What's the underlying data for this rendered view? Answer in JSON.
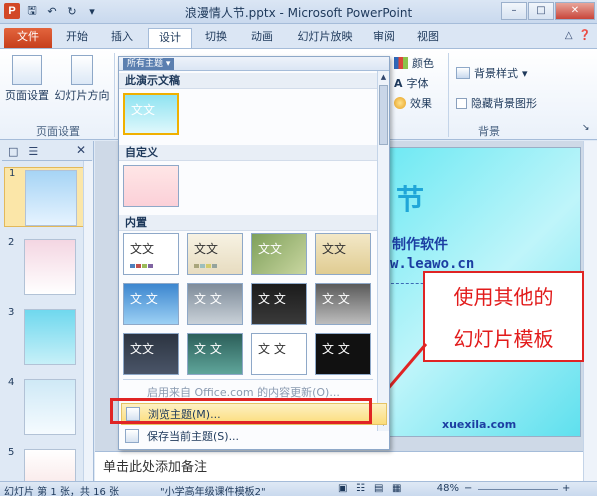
{
  "window": {
    "title": "浪漫情人节.pptx - Microsoft PowerPoint",
    "app_icon": "P"
  },
  "tabs": [
    "文件",
    "开始",
    "插入",
    "设计",
    "切换",
    "动画",
    "幻灯片放映",
    "审阅",
    "视图"
  ],
  "ribbon": {
    "page_setup": "页面设置",
    "orientation": "幻灯片方向",
    "group_page_setup": "页面设置",
    "colors": "颜色",
    "fonts": "字体",
    "effects": "效果",
    "bg_styles": "背景样式",
    "hide_bg": "隐藏背景图形",
    "group_background": "背景"
  },
  "gallery": {
    "header": "所有主题",
    "section_this": "此演示文稿",
    "section_custom": "自定义",
    "section_builtin": "内置",
    "tile_text": "文文",
    "tile_text_2": "文 文",
    "office_update": "启用来自 Office.com 的内容更新(O)...",
    "browse": "浏览主题(M)...",
    "save_current": "保存当前主题(S)..."
  },
  "slide": {
    "title_fragment": "节",
    "line1": "制作软件",
    "line2": "w.leawo.cn",
    "line3": "xuexila.com"
  },
  "thumbs": [
    "1",
    "2",
    "3",
    "4",
    "5"
  ],
  "notes_placeholder": "单击此处添加备注",
  "callout": {
    "line1": "使用其他的",
    "line2": "幻灯片模板"
  },
  "status": {
    "slide_info": "幻灯片 第 1 张，共 16 张",
    "template": "\"小学高年级课件模板2\"",
    "zoom": "48%"
  }
}
